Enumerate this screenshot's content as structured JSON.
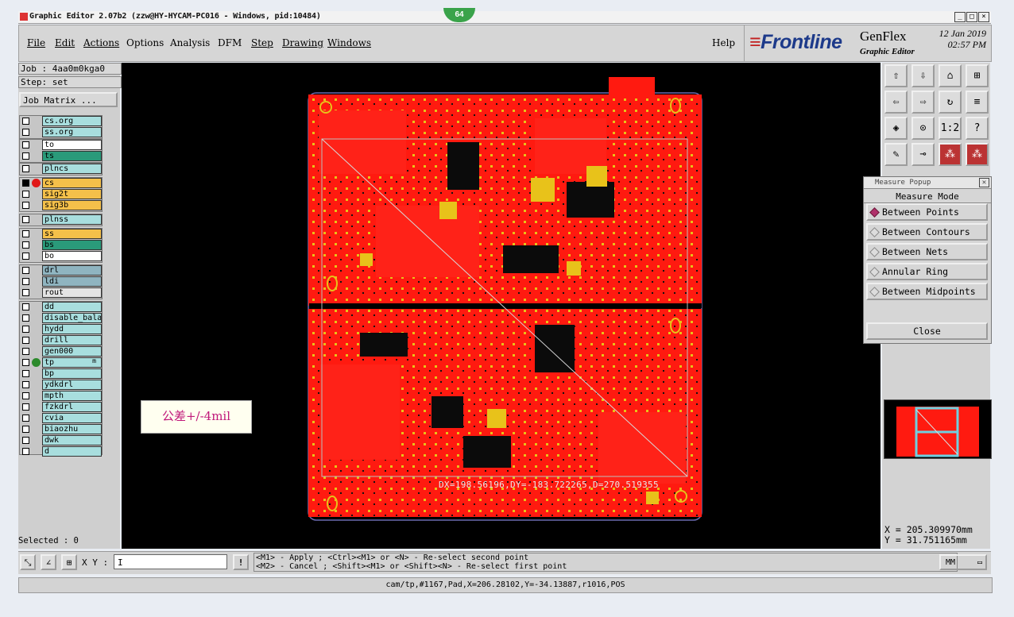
{
  "window": {
    "title": "Graphic Editor 2.07b2 (zzw@HY-HYCAM-PC016 - Windows, pid:10484)",
    "controls": [
      "_",
      "□",
      "×"
    ]
  },
  "overlay_badge": "64",
  "menu": {
    "items": [
      "File",
      "Edit",
      "Actions",
      "Options",
      "Analysis",
      "DFM",
      "Step",
      "Drawing",
      "Windows"
    ],
    "help": "Help"
  },
  "logo": {
    "brand": "Frontline",
    "product": "GenFlex",
    "subtitle": "Graphic Editor",
    "date": "12 Jan 2019",
    "time": "02:57 PM"
  },
  "left_panel": {
    "job_label": "Job : 4aa0m0kga0",
    "step_label": "Step: set",
    "job_matrix_button": "Job Matrix ...",
    "selected": "Selected : 0"
  },
  "layers": [
    {
      "name": "cs.org",
      "color": "#a8dede",
      "dot": ""
    },
    {
      "name": "ss.org",
      "color": "#a8dede",
      "dot": ""
    },
    {
      "name": "to",
      "color": "#ffffff",
      "dot": ""
    },
    {
      "name": "ts",
      "color": "#2a9a7a",
      "dot": ""
    },
    {
      "name": "plncs",
      "color": "#a8dede",
      "dot": ""
    },
    {
      "name": "cs",
      "color": "#f4c04a",
      "dot": "#e01818",
      "active": true
    },
    {
      "name": "sig2t",
      "color": "#f4c04a",
      "dot": ""
    },
    {
      "name": "sig3b",
      "color": "#f4c04a",
      "dot": ""
    },
    {
      "name": "plnss",
      "color": "#a8dede",
      "dot": ""
    },
    {
      "name": "ss",
      "color": "#f4c04a",
      "dot": ""
    },
    {
      "name": "bs",
      "color": "#2a9a7a",
      "dot": ""
    },
    {
      "name": "bo",
      "color": "#ffffff",
      "dot": ""
    },
    {
      "name": "drl",
      "color": "#8fb4c0",
      "dot": ""
    },
    {
      "name": "ldi",
      "color": "#8fb4c0",
      "dot": ""
    },
    {
      "name": "rout",
      "color": "#e4e4e4",
      "dot": ""
    },
    {
      "name": "dd",
      "color": "#a8dede",
      "dot": ""
    },
    {
      "name": "disable_bala",
      "color": "#a8dede",
      "dot": ""
    },
    {
      "name": "hydd",
      "color": "#a8dede",
      "dot": ""
    },
    {
      "name": "drill",
      "color": "#a8dede",
      "dot": ""
    },
    {
      "name": "gen000",
      "color": "#a8dede",
      "dot": ""
    },
    {
      "name": "tp",
      "color": "#a8dede",
      "dot": "#2c8a2c",
      "suffix": "m"
    },
    {
      "name": "bp",
      "color": "#a8dede",
      "dot": ""
    },
    {
      "name": "ydkdrl",
      "color": "#a8dede",
      "dot": ""
    },
    {
      "name": "mpth",
      "color": "#a8dede",
      "dot": ""
    },
    {
      "name": "fzkdrl",
      "color": "#a8dede",
      "dot": ""
    },
    {
      "name": "cvia",
      "color": "#a8dede",
      "dot": ""
    },
    {
      "name": "biaozhu",
      "color": "#a8dede",
      "dot": ""
    },
    {
      "name": "dwk",
      "color": "#a8dede",
      "dot": ""
    },
    {
      "name": "d",
      "color": "#a8dede",
      "dot": ""
    }
  ],
  "canvas": {
    "annotation": "公差+/-4mil",
    "measure_result": "DX=198.56196,DY=-183.722265,D=270.519355"
  },
  "toolbar_icons": [
    "zoom-home-icon",
    "zoom-previous-icon",
    "zoom-home-alt-icon",
    "grid-icon",
    "pan-left-icon",
    "pan-right-icon",
    "zoom-fit-icon",
    "snap-icon",
    "zoom-in-icon",
    "zoom-out-icon",
    "scale-1-2-icon",
    "help-icon",
    "measure-icon",
    "line-icon",
    "net-highlight-icon",
    "net-highlight-alt-icon"
  ],
  "toolbar_glyphs": [
    "⇧",
    "⇩",
    "⌂",
    "⊞",
    "⇦",
    "⇨",
    "↻",
    "≡",
    "◈",
    "⊙",
    "1:2",
    "?",
    "✎",
    "⊸",
    "⁂",
    "⁂"
  ],
  "measure_popup": {
    "title": "Measure Popup",
    "mode_label": "Measure Mode",
    "options": [
      "Between Points",
      "Between Contours",
      "Between Nets",
      "Annular Ring",
      "Between Midpoints"
    ],
    "selected_index": 0,
    "close_label": "Close"
  },
  "coordinates": {
    "x": "X = 205.309970mm",
    "y": "Y = 31.751165mm"
  },
  "bottom_bar": {
    "xy_label": "X Y :",
    "xy_value": "I",
    "bang": "!",
    "hint_line1": "<M1> - Apply  ; <Ctrl><M1> or <N> - Re-select second point",
    "hint_line2": "<M2> - Cancel ; <Shift><M1> or <Shift><N> - Re-select first point",
    "units": "MM"
  },
  "status_line": "cam/tp,#1167,Pad,X=206.28102,Y=-34.13887,r1016,POS"
}
